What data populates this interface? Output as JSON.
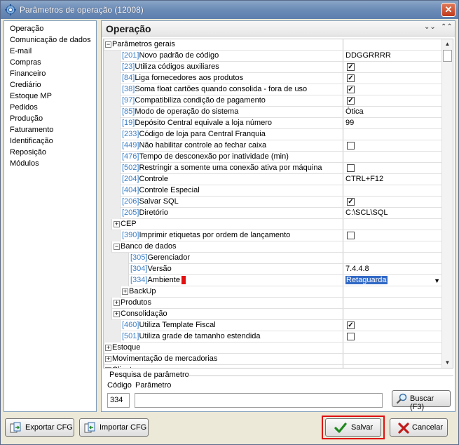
{
  "window": {
    "title": "Parâmetros de operação (12008)",
    "close_label": "✕"
  },
  "sidebar": {
    "items": [
      {
        "label": "Operação"
      },
      {
        "label": "Comunicação de dados"
      },
      {
        "label": "E-mail"
      },
      {
        "label": "Compras"
      },
      {
        "label": "Financeiro"
      },
      {
        "label": "Crediário"
      },
      {
        "label": "Estoque MP"
      },
      {
        "label": "Pedidos"
      },
      {
        "label": "Produção"
      },
      {
        "label": "Faturamento"
      },
      {
        "label": "Identificação"
      },
      {
        "label": "Reposição"
      },
      {
        "label": "Módulos"
      }
    ]
  },
  "main": {
    "title": "Operação",
    "collapse_all": "⌄⌄",
    "expand_all": "⌃⌃"
  },
  "grid": {
    "rows": [
      {
        "kind": "group",
        "level": 0,
        "expander": "⊟",
        "label": "Parâmetros gerais",
        "value": ""
      },
      {
        "kind": "param",
        "level": 1,
        "code": "[201]",
        "label": "Novo padrão de código",
        "value": "DDGGRRRR"
      },
      {
        "kind": "check",
        "level": 1,
        "code": "[23]",
        "label": "Utiliza códigos auxiliares",
        "checked": true
      },
      {
        "kind": "check",
        "level": 1,
        "code": "[84]",
        "label": "Liga fornecedores aos produtos",
        "checked": true
      },
      {
        "kind": "check",
        "level": 1,
        "code": "[38]",
        "label": "Soma float cartões quando consolida - fora de uso",
        "checked": true
      },
      {
        "kind": "check",
        "level": 1,
        "code": "[97]",
        "label": "Compatibiliza condição de pagamento",
        "checked": true
      },
      {
        "kind": "param",
        "level": 1,
        "code": "[85]",
        "label": "Modo de operação do sistema",
        "value": "Ótica"
      },
      {
        "kind": "param",
        "level": 1,
        "code": "[19]",
        "label": "Depósito Central equivale a loja número",
        "value": "99"
      },
      {
        "kind": "param",
        "level": 1,
        "code": "[233]",
        "label": "Código de loja para Central Franquia",
        "value": ""
      },
      {
        "kind": "check",
        "level": 1,
        "code": "[449]",
        "label": "Não habilitar controle ao fechar caixa",
        "checked": false
      },
      {
        "kind": "param",
        "level": 1,
        "code": "[476]",
        "label": "Tempo de desconexão por inatividade (min)",
        "value": ""
      },
      {
        "kind": "check",
        "level": 1,
        "code": "[502]",
        "label": "Restringir a somente uma conexão ativa por máquina",
        "checked": false
      },
      {
        "kind": "param",
        "level": 1,
        "code": "[204]",
        "label": "Controle",
        "value": "CTRL+F12"
      },
      {
        "kind": "param",
        "level": 1,
        "code": "[404]",
        "label": "Controle Especial",
        "value": ""
      },
      {
        "kind": "check",
        "level": 1,
        "code": "[206]",
        "label": "Salvar SQL",
        "checked": true
      },
      {
        "kind": "param",
        "level": 1,
        "code": "[205]",
        "label": "Diretório",
        "value": "C:\\SCL\\SQL"
      },
      {
        "kind": "group",
        "level": 1,
        "expander": "⊞",
        "label": "CEP",
        "value": ""
      },
      {
        "kind": "check",
        "level": 1,
        "code": "[390]",
        "label": "Imprimir etiquetas por ordem de lançamento",
        "checked": false
      },
      {
        "kind": "group",
        "level": 1,
        "expander": "⊟",
        "label": "Banco de dados",
        "value": ""
      },
      {
        "kind": "param",
        "level": 2,
        "code": "[305]",
        "label": "Gerenciador",
        "value": ""
      },
      {
        "kind": "param",
        "level": 2,
        "code": "[304]",
        "label": "Versão",
        "value": "7.4.4.8"
      },
      {
        "kind": "select",
        "level": 2,
        "code": "[334]",
        "label": "Ambiente",
        "value": "Retaguarda",
        "arrow": "▼"
      },
      {
        "kind": "group",
        "level": 2,
        "expander": "⊞",
        "label": "BackUp",
        "value": ""
      },
      {
        "kind": "group",
        "level": 1,
        "expander": "⊞",
        "label": "Produtos",
        "value": ""
      },
      {
        "kind": "group",
        "level": 1,
        "expander": "⊞",
        "label": "Consolidação",
        "value": ""
      },
      {
        "kind": "check",
        "level": 1,
        "code": "[460]",
        "label": "Utiliza Template Fiscal",
        "checked": true
      },
      {
        "kind": "check",
        "level": 1,
        "code": "[501]",
        "label": "Utiliza grade de tamanho estendida",
        "checked": false
      },
      {
        "kind": "group",
        "level": 0,
        "expander": "⊞",
        "label": "Estoque",
        "value": ""
      },
      {
        "kind": "group",
        "level": 0,
        "expander": "⊞",
        "label": "Movimentação de mercadorias",
        "value": ""
      },
      {
        "kind": "group",
        "level": 0,
        "expander": "⊞",
        "label": "Cliente",
        "value": ""
      }
    ],
    "check_mark": "✓",
    "scroll_up": "▲",
    "scroll_down": "▼"
  },
  "search": {
    "title": "Pesquisa de parâmetro",
    "codigo_label": "Código",
    "parametro_label": "Parâmetro",
    "codigo_value": "334",
    "parametro_value": "",
    "buscar_label": "Buscar (F3)"
  },
  "footer": {
    "exportar_label": "Exportar CFG",
    "importar_label": "Importar CFG",
    "salvar_label": "Salvar",
    "cancelar_label": "Cancelar"
  }
}
